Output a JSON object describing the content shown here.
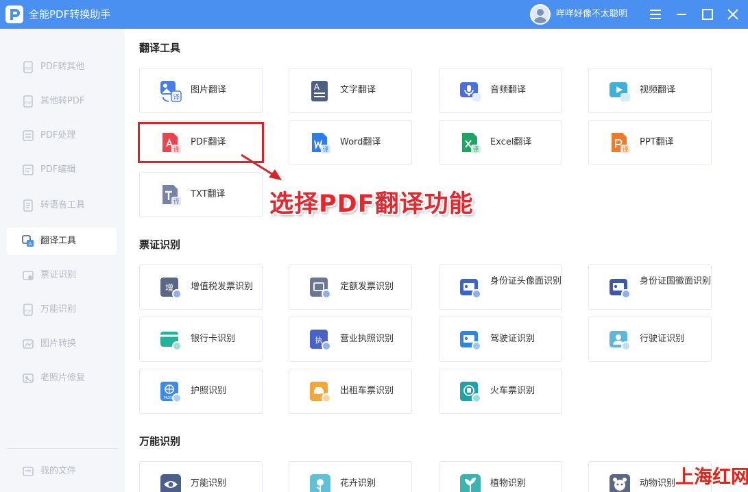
{
  "app": {
    "title": "全能PDF转换助手",
    "user_name": "咩咩好像不太聪明",
    "accent_color": "#4a90f0",
    "window_controls": [
      "menu-icon",
      "minimize-icon",
      "maximize-icon",
      "close-icon"
    ]
  },
  "sidebar": {
    "items": [
      {
        "label": "PDF转其他",
        "icon": "pdf-export-icon",
        "active": false
      },
      {
        "label": "其他转PDF",
        "icon": "pdf-import-icon",
        "active": false
      },
      {
        "label": "PDF处理",
        "icon": "pdf-process-icon",
        "active": false
      },
      {
        "label": "PDF编辑",
        "icon": "pdf-edit-icon",
        "active": false
      },
      {
        "label": "转语音工具",
        "icon": "voice-doc-icon",
        "active": false
      },
      {
        "label": "翻译工具",
        "icon": "translate-icon",
        "active": true
      },
      {
        "label": "票证识别",
        "icon": "ticket-icon",
        "active": false
      },
      {
        "label": "万能识别",
        "icon": "ocr-icon",
        "active": false
      },
      {
        "label": "图片转换",
        "icon": "image-convert-icon",
        "active": false
      },
      {
        "label": "老照片修复",
        "icon": "photo-repair-icon",
        "active": false
      }
    ],
    "my_files": "我的文件"
  },
  "sections": [
    {
      "title": "翻译工具",
      "cards": [
        {
          "label": "图片翻译",
          "icon": "image-translate-icon"
        },
        {
          "label": "文字翻译",
          "icon": "text-translate-icon"
        },
        {
          "label": "音频翻译",
          "icon": "audio-translate-icon"
        },
        {
          "label": "视频翻译",
          "icon": "video-translate-icon"
        },
        {
          "label": "PDF翻译",
          "icon": "pdf-translate-icon"
        },
        {
          "label": "Word翻译",
          "icon": "word-translate-icon"
        },
        {
          "label": "Excel翻译",
          "icon": "excel-translate-icon"
        },
        {
          "label": "PPT翻译",
          "icon": "ppt-translate-icon"
        },
        {
          "label": "TXT翻译",
          "icon": "txt-translate-icon"
        }
      ]
    },
    {
      "title": "票证识别",
      "cards": [
        {
          "label": "增值税发票识别",
          "icon": "vat-invoice-icon"
        },
        {
          "label": "定额发票识别",
          "icon": "quota-invoice-icon"
        },
        {
          "label": "身份证头像面识别",
          "icon": "id-card-front-icon"
        },
        {
          "label": "身份证国徽面识别",
          "icon": "id-card-back-icon"
        },
        {
          "label": "银行卡识别",
          "icon": "bank-card-icon"
        },
        {
          "label": "营业执照识别",
          "icon": "business-license-icon"
        },
        {
          "label": "驾驶证识别",
          "icon": "driver-license-icon"
        },
        {
          "label": "行驶证识别",
          "icon": "vehicle-license-icon"
        },
        {
          "label": "护照识别",
          "icon": "passport-icon"
        },
        {
          "label": "出租车票识别",
          "icon": "taxi-ticket-icon"
        },
        {
          "label": "火车票识别",
          "icon": "train-ticket-icon"
        }
      ]
    },
    {
      "title": "万能识别",
      "cards": [
        {
          "label": "万能识别",
          "icon": "eye-scan-icon"
        },
        {
          "label": "花卉识别",
          "icon": "flower-icon"
        },
        {
          "label": "植物识别",
          "icon": "plant-icon"
        },
        {
          "label": "动物识别",
          "icon": "animal-icon"
        }
      ]
    }
  ],
  "annotation": {
    "text": "选择PDF翻译功能",
    "color": "#e8262c"
  },
  "watermark": "上海红网"
}
